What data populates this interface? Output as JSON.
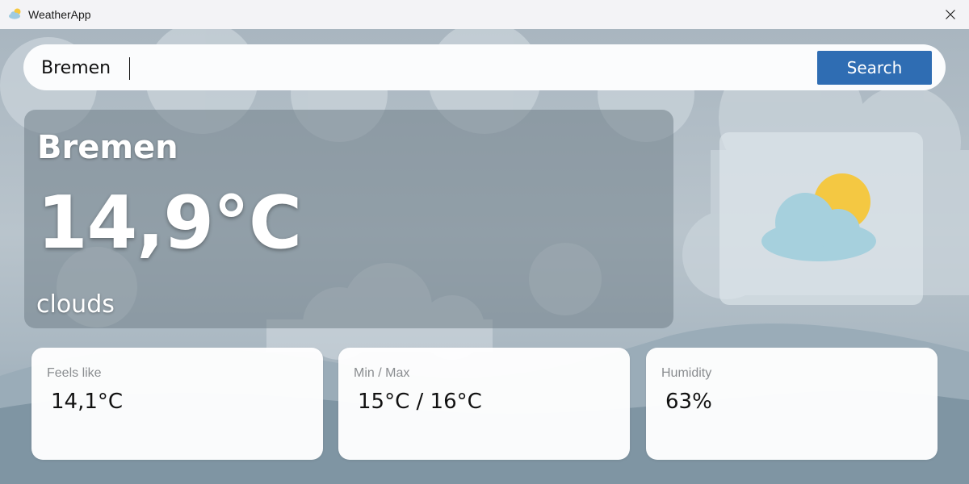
{
  "window": {
    "title": "WeatherApp",
    "icon": "partly-cloudy-icon",
    "close_icon": "close-icon"
  },
  "search": {
    "value": "Bremen",
    "placeholder": "",
    "button_label": "Search"
  },
  "current": {
    "city": "Bremen",
    "temperature": "14,9°C",
    "condition": "clouds",
    "icon": "partly-cloudy-icon"
  },
  "stats": [
    {
      "label": "Feels like",
      "value": "14,1°C"
    },
    {
      "label": "Min / Max",
      "value": "15°C / 16°C"
    },
    {
      "label": "Humidity",
      "value": "63%"
    }
  ],
  "colors": {
    "accent": "#2f6db3",
    "cloud": "#a8d3e0",
    "sun": "#f5c842"
  }
}
